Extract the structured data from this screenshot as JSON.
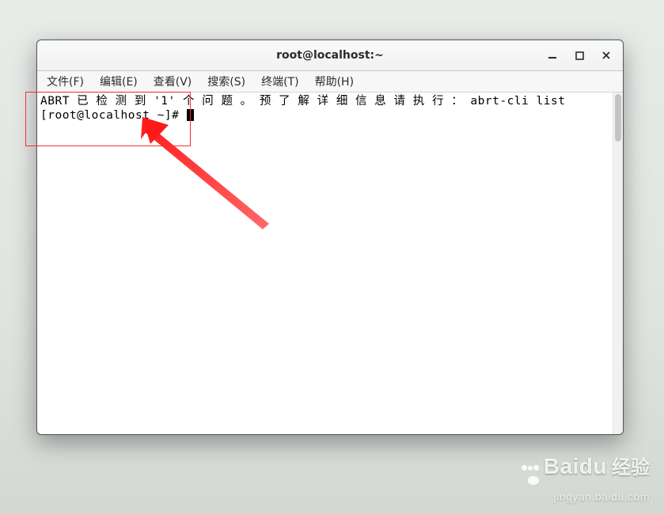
{
  "window": {
    "title": "root@localhost:~"
  },
  "menubar": {
    "items": [
      {
        "label": "文件(F)"
      },
      {
        "label": "编辑(E)"
      },
      {
        "label": "查看(V)"
      },
      {
        "label": "搜索(S)"
      },
      {
        "label": "终端(T)"
      },
      {
        "label": "帮助(H)"
      }
    ]
  },
  "terminal": {
    "line1": "ABRT 已 检 测 到 '1' 个 问 题 。 预 了 解 详 细 信 息 请 执 行 ： abrt-cli list",
    "prompt": "[root@localhost ~]# "
  },
  "watermark": {
    "brand": "Baidu",
    "cn": "经验",
    "url": "jingyan.baidu.com"
  }
}
